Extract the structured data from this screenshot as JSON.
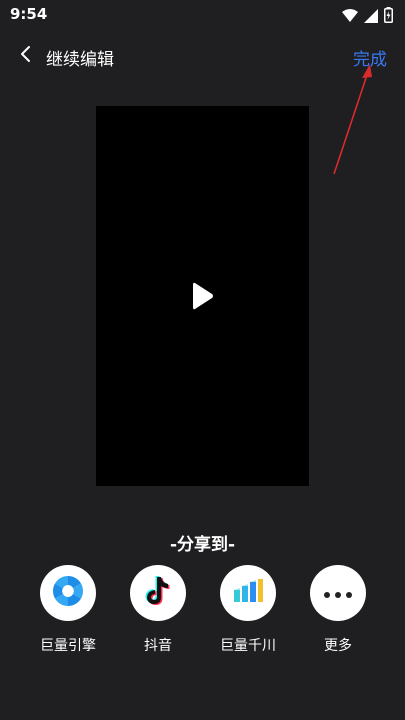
{
  "status_bar": {
    "time": "9:54",
    "icons": [
      "wifi-icon",
      "signal-icon",
      "battery-icon"
    ]
  },
  "header": {
    "back_icon": "chevron-left-icon",
    "title": "继续编辑",
    "done_label": "完成"
  },
  "preview": {
    "play_icon": "play-icon"
  },
  "share": {
    "title": "-分享到-",
    "items": [
      {
        "label": "巨量引擎",
        "icon": "juliang-engine-icon"
      },
      {
        "label": "抖音",
        "icon": "douyin-icon"
      },
      {
        "label": "巨量千川",
        "icon": "juliang-qianchuan-icon"
      },
      {
        "label": "更多",
        "icon": "more-dots-icon"
      }
    ]
  },
  "colors": {
    "background": "#1f1f22",
    "accent": "#3a78f2",
    "annotation_arrow": "#d92b2b"
  }
}
